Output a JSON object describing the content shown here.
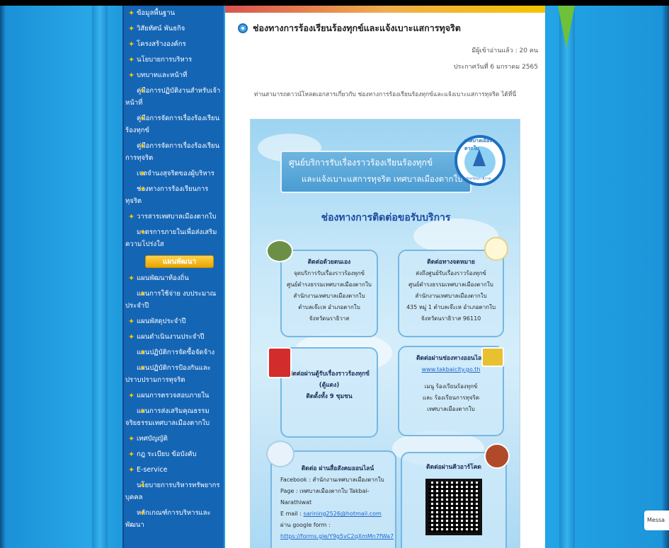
{
  "sidebar": {
    "items_top": [
      "ข้อมูลพื้นฐาน",
      "วิสัยทัศน์ พันธกิจ",
      "โครงสร้างองค์กร",
      "นโยบายการบริหาร",
      "บทบาทและหน้าที่",
      "คู่มือการปฏิบัติงานสำหรับเจ้าหน้าที่",
      "คู่มือการจัดการเรื่องร้องเรียนร้องทุกข์",
      "คู่มือการจัดการเรื่องร้องเรียนการทุจริต",
      "เจตจำนงสุจริตของผู้บริหาร",
      "ช่องทางการร้องเรียนการทุจริต",
      "วารสารเทศบาลเมืองตากใบ",
      "มาตรการภายในเพื่อส่งเสริมความโปร่งใส"
    ],
    "section_header": "แผนพัฒนา",
    "items_bottom": [
      "แผนพัฒนาท้องถิ่น",
      "แผนการใช้จ่าย งบประมาณประจำปี",
      "แผนพัสดุประจำปี",
      "แผนดำเนินงานประจำปี",
      "แผนปฏิบัติการจัดซื้อจัดจ้าง",
      "แผนปฏิบัติการป้องกันและปราบปรามการทุจริต",
      "แผนการตรวจสอบภายใน",
      "แผนการส่งเสริมคุณธรรมจริยธรรมเทศบาลเมืองตากใบ",
      "เทศบัญญัติ",
      "กฎ ระเบียบ ข้อบังคับ",
      "E-service",
      "นโยบายการบริหารทรัพยากรบุคคล",
      "หลักเกณฑ์การบริหารและพัฒนา"
    ]
  },
  "page": {
    "title": "ช่องทางการร้องเรียนร้องทุกข์และแจ้งเบาะแสการทุจริต",
    "readers": "มีผู้เข้าอ่านแล้ว : 20 คน",
    "date": "ประกาศวันที่ 6 มกราคม 2565",
    "description": "ท่านสามารถดาวน์โหลดเอกสารเกี่ยวกับ ช่องทางการร้องเรียนร้องทุกข์และแจ้งเบาะแสการทุจริต ได้ที่นี่"
  },
  "poster": {
    "banner_line1": "ศูนย์บริการรับเรื่องราวร้องเรียนร้องทุกข์",
    "banner_line2": "และแจ้งเบาะแสการทุจริต เทศบาลเมืองตากใบ",
    "logo_text": "เทศบาลเมืองตากใบ",
    "logo_bottom": "จังหวัดนราธิวาส",
    "contact_title": "ช่องทางการติดต่อขอรับบริการ",
    "box_self": {
      "heading": "ติดต่อด้วยตนเอง",
      "lines": [
        "จุดบริการรับเรื่องราวร้องทุกข์",
        "ศูนย์ดำรงธรรมเทศบาลเมืองตากใบ",
        "สำนักงานเทศบาลเมืองตากใบ",
        "ตำบลเจ๊ะเห อำเภอตากใบ",
        "จังหวัดนราธิวาส"
      ]
    },
    "box_mail": {
      "heading": "ติดต่อทางจดหมาย",
      "lines": [
        "ส่งถึงศูนย์รับเรื่องราวร้องทุกข์",
        "ศูนย์ดำรงธรรมเทศบาลเมืองตากใบ",
        "สำนักงานเทศบาลเมืองตากใบ",
        "435 หมู่ 1 ตำบลเจ๊ะเห อำเภอตากใบ",
        "จังหวัดนราธิวาส 96110"
      ]
    },
    "box_box": {
      "heading": "ติดต่อผ่านตู้รับเรื่องราวร้องทุกข์",
      "sub": "(ตู้แดง)",
      "line": "ติดตั้งทั้ง 9 ชุมชน"
    },
    "box_online": {
      "heading": "ติดต่อผ่านช่องทางออนไลน์",
      "link": "www.takbaicity.go.th",
      "lines": [
        "เมนู ร้องเรียนร้องทุกข์",
        "และ ร้องเรียนการทุจริต",
        "เทศบาลเมืองตากใบ"
      ]
    },
    "box_social": {
      "heading": "ติดต่อ ผ่านสื่อสังคมออนไลน์",
      "facebook": "Facebook : สำนักงานเทศบาลเมืองตากใบ",
      "page": "Page : เทศบาลเมืองตากใบ Takbai-Narathiwat",
      "email_label": "E mail : ",
      "email": "sarining2526@hotmail.com",
      "form_label": "ผ่าน google form :",
      "form_link": "https://forms.gle/Y9g5vC2qXmMn7fWa7"
    },
    "box_qr": {
      "heading": "ติดต่อผ่านคิวอาร์โคด"
    }
  },
  "messenger": "Messa",
  "icons": [
    "bullet-icon",
    "title-icon",
    "house-icon",
    "mail-icon",
    "postbox-icon",
    "shop-icon",
    "social-icon",
    "tools-icon",
    "qr-code-icon",
    "logo-icon"
  ]
}
